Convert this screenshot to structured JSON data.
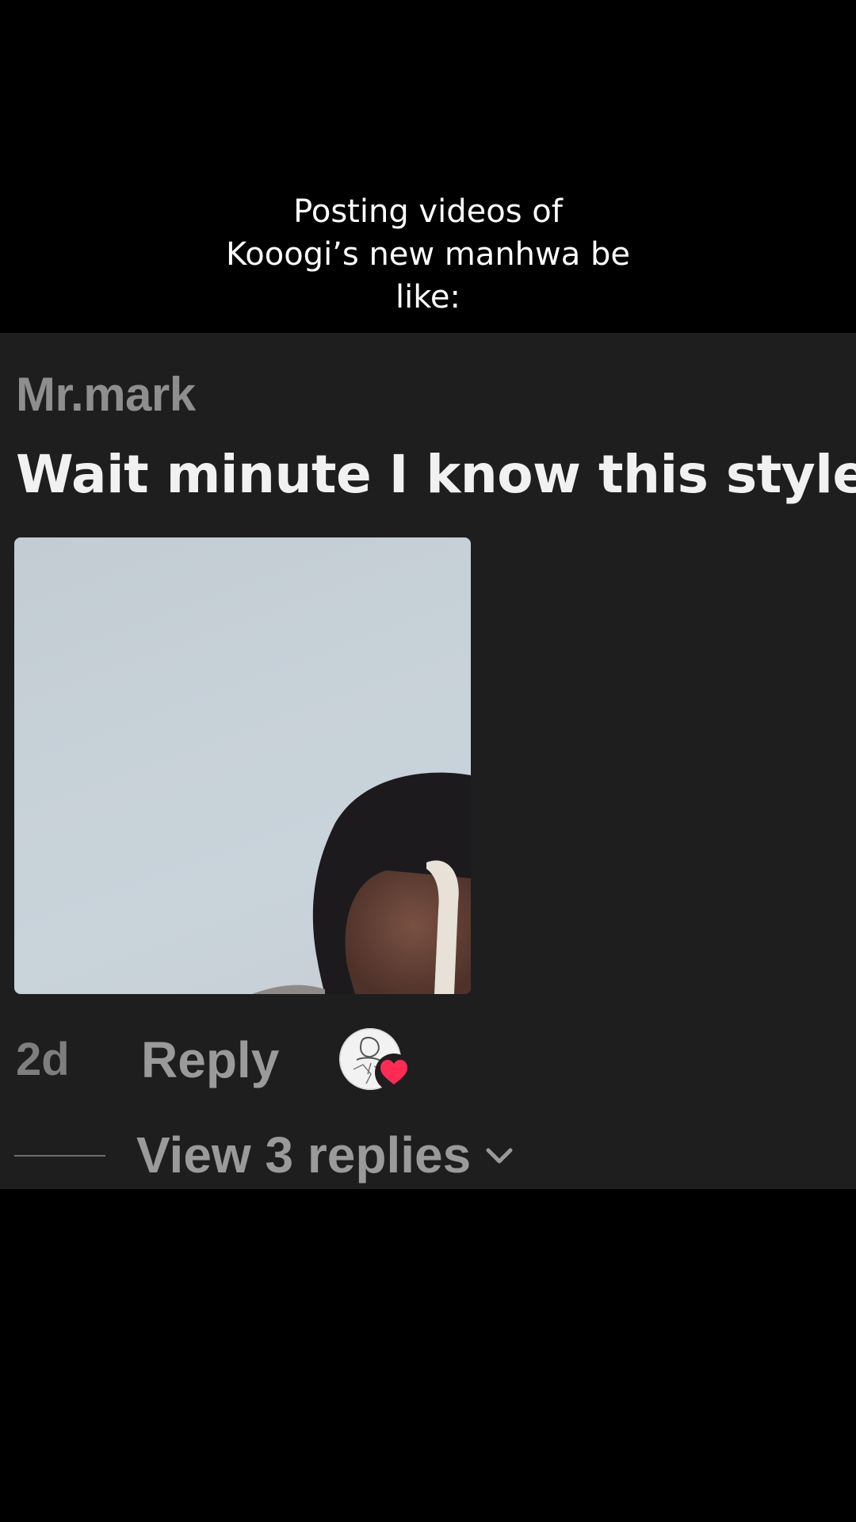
{
  "caption": {
    "lines": [
      "Posting videos of",
      "Kooogi’s new manhwa be",
      "like:"
    ]
  },
  "comment": {
    "username": "Mr.mark",
    "text": "Wait minute I know this style",
    "time": "2d",
    "reply_label": "Reply",
    "view_replies_label": "View 3 replies"
  },
  "icons": {
    "liker_avatar": "avatar-drawing-icon",
    "liked_badge": "heart-icon",
    "expand": "chevron-down-icon"
  },
  "colors": {
    "panel_background": "#1e1e1f",
    "username": "#8e8e8f",
    "comment_text": "#f1f1f1",
    "heart": "#fe2c55"
  }
}
